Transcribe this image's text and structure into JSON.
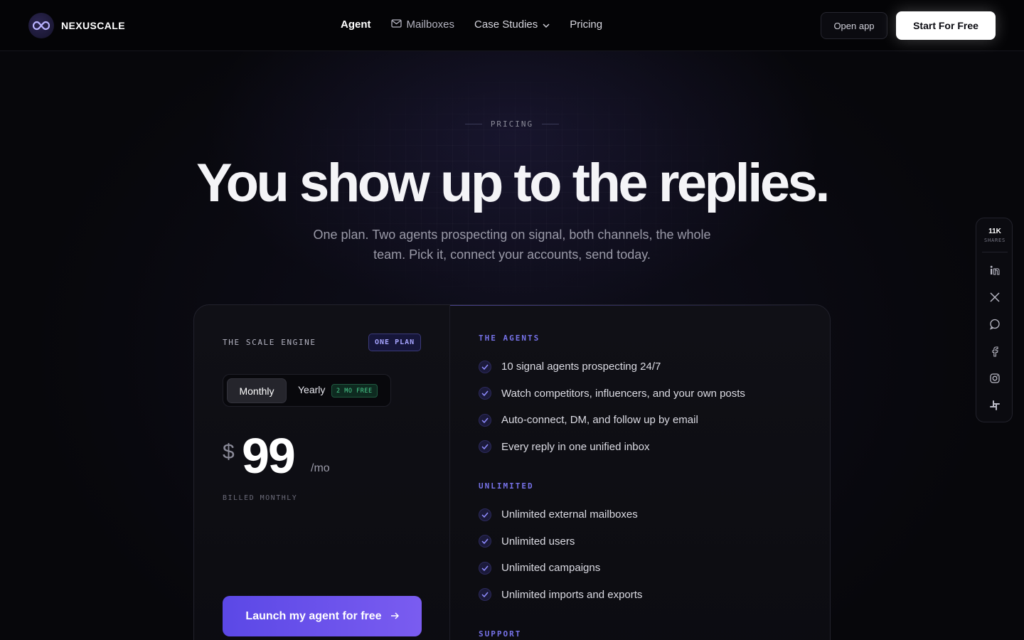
{
  "brand": {
    "name": "NEXUSCALE"
  },
  "nav": {
    "items": [
      {
        "label": "Agent"
      },
      {
        "label": "Mailboxes"
      },
      {
        "label": "Case Studies"
      },
      {
        "label": "Pricing"
      }
    ],
    "open_app": "Open app",
    "start_free": "Start For Free"
  },
  "hero": {
    "eyebrow": "PRICING",
    "title": "You show up to the replies.",
    "subtitle": "One plan. Two agents prospecting on signal, both channels, the whole team. Pick it, connect your accounts, send today."
  },
  "plan": {
    "name": "THE SCALE ENGINE",
    "badge": "ONE PLAN",
    "toggle": {
      "monthly": "Monthly",
      "yearly": "Yearly",
      "yearly_tag": "2 MO FREE",
      "selected": "Monthly"
    },
    "currency": "$",
    "price": "99",
    "period": "/mo",
    "billing_note": "BILLED MONTHLY",
    "cta": "Launch my agent for free"
  },
  "features": {
    "agents": {
      "title": "THE AGENTS",
      "items": [
        "10 signal agents prospecting 24/7",
        "Watch competitors, influencers, and your own posts",
        "Auto-connect, DM, and follow up by email",
        "Every reply in one unified inbox"
      ]
    },
    "unlimited": {
      "title": "UNLIMITED",
      "items": [
        "Unlimited external mailboxes",
        "Unlimited users",
        "Unlimited campaigns",
        "Unlimited imports and exports"
      ]
    },
    "support": {
      "title": "SUPPORT"
    }
  },
  "share": {
    "count": "11K",
    "label": "SHARES",
    "icons": [
      "linkedin-icon",
      "x-icon",
      "whatsapp-icon",
      "facebook-icon",
      "instagram-icon",
      "slack-icon"
    ]
  },
  "colors": {
    "accent": "#7672e8",
    "cta_gradient_start": "#5b48e6",
    "cta_gradient_end": "#7a5cf0",
    "tag_green": "#4ad08f",
    "background": "#07070b"
  }
}
